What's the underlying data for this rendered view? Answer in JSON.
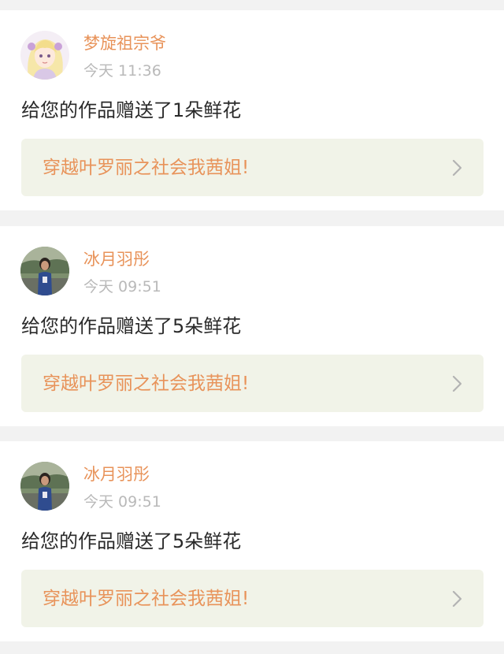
{
  "accent_color": "#e8935a",
  "feed": [
    {
      "user_name": "梦旋祖宗爷",
      "time": "今天 11:36",
      "message": "给您的作品赠送了1朵鲜花",
      "work_title": "穿越叶罗丽之社会我茜姐!",
      "avatar": "anime-girl-avatar",
      "chevron": "chevron-right-icon"
    },
    {
      "user_name": "冰月羽彤",
      "time": "今天 09:51",
      "message": "给您的作品赠送了5朵鲜花",
      "work_title": "穿越叶罗丽之社会我茜姐!",
      "avatar": "photo-girl-avatar",
      "chevron": "chevron-right-icon"
    },
    {
      "user_name": "冰月羽彤",
      "time": "今天 09:51",
      "message": "给您的作品赠送了5朵鲜花",
      "work_title": "穿越叶罗丽之社会我茜姐!",
      "avatar": "photo-girl-avatar",
      "chevron": "chevron-right-icon"
    }
  ]
}
